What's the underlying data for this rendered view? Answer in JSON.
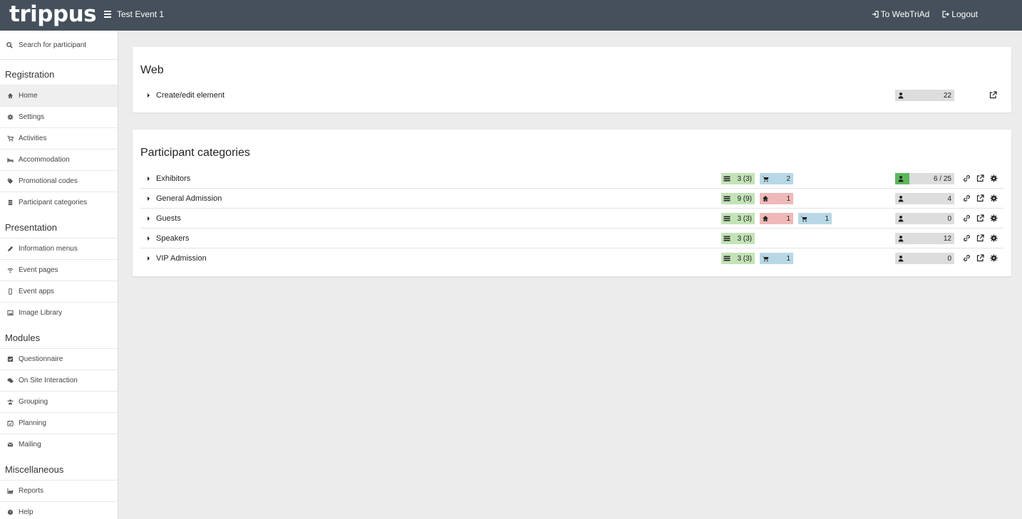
{
  "app": {
    "logo": "trippus",
    "event_title": "Test Event 1"
  },
  "top_links": {
    "webtriad": "To WebTriAd",
    "logout": "Logout"
  },
  "sidebar": {
    "search_label": "Search for participant",
    "sections": {
      "registration": "Registration",
      "presentation": "Presentation",
      "modules": "Modules",
      "misc": "Miscellaneous"
    },
    "items": {
      "home": "Home",
      "settings": "Settings",
      "activities": "Activities",
      "accommodation": "Accommodation",
      "promo": "Promotional codes",
      "categories": "Participant categories",
      "info_menus": "Information menus",
      "event_pages": "Event pages",
      "event_apps": "Event apps",
      "image_library": "Image Library",
      "questionnaire": "Questionnaire",
      "onsite": "On Site Interaction",
      "grouping": "Grouping",
      "planning": "Planning",
      "mailing": "Mailing",
      "reports": "Reports",
      "help": "Help"
    }
  },
  "web_card": {
    "title": "Web",
    "row_label": "Create/edit element",
    "count": "22"
  },
  "categories_card": {
    "title": "Participant categories",
    "rows": [
      {
        "label": "Exhibitors",
        "fields": "3 (3)",
        "cart": "2",
        "count": "6 / 25",
        "fill_fraction": 0.24
      },
      {
        "label": "General Admission",
        "fields": "9 (9)",
        "home": "1",
        "count": "4"
      },
      {
        "label": "Guests",
        "fields": "3 (3)",
        "home": "1",
        "cart": "1",
        "count": "0"
      },
      {
        "label": "Speakers",
        "fields": "3 (3)",
        "count": "12"
      },
      {
        "label": "VIP Admission",
        "fields": "3 (3)",
        "cart": "1",
        "count": "0"
      }
    ]
  },
  "colors": {
    "topbar": "#45505c",
    "fields_badge": "#c3e3b7",
    "home_badge": "#f0b9b9",
    "cart_badge": "#b8d8e6",
    "count_fill": "#5cb85c"
  }
}
